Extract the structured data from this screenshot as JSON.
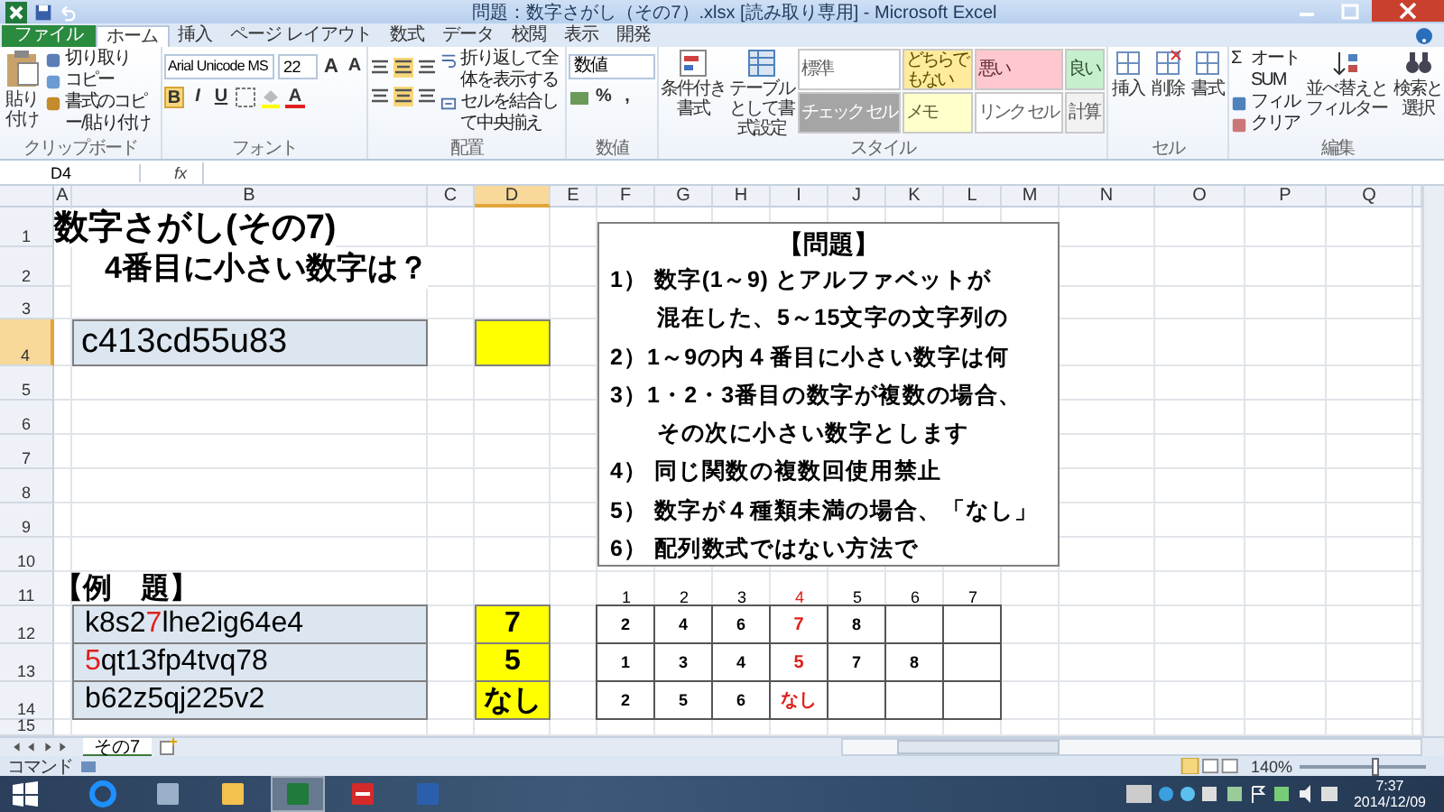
{
  "window": {
    "title": "問題：数字さがし（その7）.xlsx [読み取り専用] - Microsoft Excel"
  },
  "ribbon_tabs": [
    {
      "label": "ファイル",
      "kind": "file",
      "selected": false
    },
    {
      "label": "ホーム",
      "kind": "tab",
      "selected": true
    },
    {
      "label": "挿入",
      "kind": "tab",
      "selected": false
    },
    {
      "label": "ページ レイアウト",
      "kind": "tab",
      "selected": false
    },
    {
      "label": "数式",
      "kind": "tab",
      "selected": false
    },
    {
      "label": "データ",
      "kind": "tab",
      "selected": false
    },
    {
      "label": "校閲",
      "kind": "tab",
      "selected": false
    },
    {
      "label": "表示",
      "kind": "tab",
      "selected": false
    },
    {
      "label": "開発",
      "kind": "tab",
      "selected": false
    }
  ],
  "ribbon": {
    "clipboard": {
      "paste": "貼り付け",
      "items": [
        "切り取り",
        "コピー",
        "書式のコピー/貼り付け"
      ],
      "label": "クリップボード"
    },
    "font": {
      "name": "Arial Unicode MS",
      "size": "22",
      "grow": "A",
      "shrink": "A",
      "styles": [
        "B",
        "I",
        "U"
      ],
      "font_color_button": "A",
      "label": "フォント"
    },
    "alignment": {
      "wrap": "折り返して全体を表示する",
      "merge": "セルを結合して中央揃え",
      "label": "配置"
    },
    "number": {
      "format": "数値",
      "percent": "%",
      "comma": ",",
      "label": "数値"
    },
    "styles": {
      "conditional": "条件付き書式",
      "table": "テーブルとして書式設定",
      "label": "スタイル",
      "cells": [
        {
          "label": "標準",
          "color": "#ffffff"
        },
        {
          "label": "どちらでもない",
          "color": "#ffeb9c"
        },
        {
          "label": "悪い",
          "color": "#ffc7ce"
        },
        {
          "label": "良い",
          "color": "#c6efce"
        },
        {
          "label": "チェック セル",
          "color": "#a5a5a5"
        },
        {
          "label": "メモ",
          "color": "#ffffcc"
        },
        {
          "label": "リンク セル",
          "color": "#ffffff"
        },
        {
          "label": "計算",
          "color": "#f2f2f2"
        }
      ]
    },
    "cells": {
      "buttons": [
        "挿入",
        "削除",
        "書式"
      ],
      "label": "セル"
    },
    "editing": {
      "sigma": "Σ",
      "items": [
        "オート SUM",
        "フィル",
        "クリア"
      ],
      "sort": "並べ替えとフィルター",
      "find": "検索と選択",
      "label": "編集"
    }
  },
  "formula_bar": {
    "name_box": "D4",
    "fx": "fx"
  },
  "sheet": {
    "columns": [
      {
        "label": "A",
        "selected": false
      },
      {
        "label": "B",
        "selected": false
      },
      {
        "label": "C",
        "selected": false
      },
      {
        "label": "D",
        "selected": true
      },
      {
        "label": "E",
        "selected": false
      },
      {
        "label": "F",
        "selected": false
      },
      {
        "label": "G",
        "selected": false
      },
      {
        "label": "H",
        "selected": false
      },
      {
        "label": "I",
        "selected": false
      },
      {
        "label": "J",
        "selected": false
      },
      {
        "label": "K",
        "selected": false
      },
      {
        "label": "L",
        "selected": false
      },
      {
        "label": "M",
        "selected": false
      },
      {
        "label": "N",
        "selected": false
      },
      {
        "label": "O",
        "selected": false
      },
      {
        "label": "P",
        "selected": false
      },
      {
        "label": "Q",
        "selected": false
      }
    ],
    "rows": [
      {
        "label": "1",
        "selected": false
      },
      {
        "label": "2",
        "selected": false
      },
      {
        "label": "3",
        "selected": false
      },
      {
        "label": "4",
        "selected": true
      },
      {
        "label": "5",
        "selected": false
      },
      {
        "label": "6",
        "selected": false
      },
      {
        "label": "7",
        "selected": false
      },
      {
        "label": "8",
        "selected": false
      },
      {
        "label": "9",
        "selected": false
      },
      {
        "label": "10",
        "selected": false
      },
      {
        "label": "11",
        "selected": false
      },
      {
        "label": "12",
        "selected": false
      },
      {
        "label": "13",
        "selected": false
      },
      {
        "label": "14",
        "selected": false
      },
      {
        "label": "15",
        "selected": false
      }
    ],
    "title": "数字さがし(その7)",
    "subtitle": "4番目に小さい数字は？",
    "puzzle": "c413cd55u83",
    "problem": {
      "heading": "【問題】",
      "lines": [
        {
          "text": "1） 数字(1～9) とアルファベットが",
          "kind": "item"
        },
        {
          "text": "混在した、5～15文字の文字列の",
          "kind": "continuation"
        },
        {
          "text": "2）1～9の内４番目に小さい数字は何",
          "kind": "item"
        },
        {
          "text": "3）1・2・3番目の数字が複数の場合、",
          "kind": "item"
        },
        {
          "text": "その次に小さい数字とします",
          "kind": "continuation"
        },
        {
          "text": "4） 同じ関数の複数回使用禁止",
          "kind": "item"
        },
        {
          "text": "5） 数字が４種類未満の場合、「なし」",
          "kind": "item"
        },
        {
          "text": "6） 配列数式ではない方法で",
          "kind": "item"
        }
      ]
    },
    "examples_label": "【例　題】",
    "rank_headers": [
      {
        "label": "1",
        "highlighted": false
      },
      {
        "label": "2",
        "highlighted": false
      },
      {
        "label": "3",
        "highlighted": false
      },
      {
        "label": "4",
        "highlighted": true
      },
      {
        "label": "5",
        "highlighted": false
      },
      {
        "label": "6",
        "highlighted": false
      },
      {
        "label": "7",
        "highlighted": false
      }
    ],
    "examples": [
      {
        "segments": [
          {
            "text": "k8s2",
            "highlighted": false
          },
          {
            "text": "7",
            "highlighted": true
          },
          {
            "text": "lhe2ig64e4",
            "highlighted": false
          }
        ],
        "answer": "7",
        "values": [
          {
            "value": "2",
            "highlighted": false
          },
          {
            "value": "4",
            "highlighted": false
          },
          {
            "value": "6",
            "highlighted": false
          },
          {
            "value": "7",
            "highlighted": true
          },
          {
            "value": "8",
            "highlighted": false
          }
        ]
      },
      {
        "segments": [
          {
            "text": "5",
            "highlighted": true
          },
          {
            "text": "qt13fp4tvq78",
            "highlighted": false
          }
        ],
        "answer": "5",
        "values": [
          {
            "value": "1",
            "highlighted": false
          },
          {
            "value": "3",
            "highlighted": false
          },
          {
            "value": "4",
            "highlighted": false
          },
          {
            "value": "5",
            "highlighted": true
          },
          {
            "value": "7",
            "highlighted": false
          },
          {
            "value": "8",
            "highlighted": false
          }
        ]
      },
      {
        "segments": [
          {
            "text": "b62z5qj225v2",
            "highlighted": false
          }
        ],
        "answer": "なし",
        "values": [
          {
            "value": "2",
            "highlighted": false
          },
          {
            "value": "5",
            "highlighted": false
          },
          {
            "value": "6",
            "highlighted": false
          },
          {
            "value": "なし",
            "highlighted": true
          }
        ]
      }
    ]
  },
  "sheet_tabs": [
    {
      "label": "その7",
      "selected": true
    }
  ],
  "status_bar": {
    "mode": "コマンド",
    "zoom": "140%",
    "zoom_slider": {
      "level": 0.6
    }
  },
  "taskbar": {
    "apps": [
      {
        "kind": "ie",
        "active": false
      },
      {
        "kind": "explorer",
        "active": false
      },
      {
        "kind": "folder",
        "active": false
      },
      {
        "kind": "excel",
        "active": true
      },
      {
        "kind": "red",
        "active": false
      },
      {
        "kind": "word",
        "active": false
      }
    ],
    "time": "7:37",
    "date": "2014/12/09"
  }
}
